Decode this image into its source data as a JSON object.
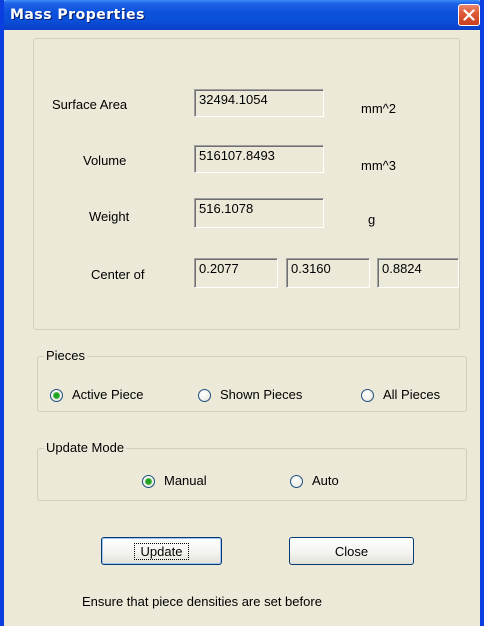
{
  "window": {
    "title": "Mass Properties"
  },
  "properties": {
    "surface_area": {
      "label": "Surface Area",
      "value": "32494.1054",
      "unit": "mm^2"
    },
    "volume": {
      "label": "Volume",
      "value": "516107.8493",
      "unit": "mm^3"
    },
    "weight": {
      "label": "Weight",
      "value": "516.1078",
      "unit": "g"
    },
    "center": {
      "label": "Center of",
      "x": "0.2077",
      "y": "0.3160",
      "z": "0.8824"
    }
  },
  "pieces": {
    "legend": "Pieces",
    "options": [
      "Active Piece",
      "Shown Pieces",
      "All Pieces"
    ],
    "selected": "Active Piece"
  },
  "update_mode": {
    "legend": "Update Mode",
    "options": [
      "Manual",
      "Auto"
    ],
    "selected": "Manual"
  },
  "buttons": {
    "update": "Update",
    "close": "Close"
  },
  "footer_text": "Ensure that piece densities are set before",
  "icons": {
    "close": "close-x-icon",
    "radio": "radio-button-icon"
  },
  "colors": {
    "titlebar": "#0a50da",
    "dialog_bg": "#ece9d8",
    "close_button": "#e0593a",
    "radio_selected": "#21a121"
  }
}
